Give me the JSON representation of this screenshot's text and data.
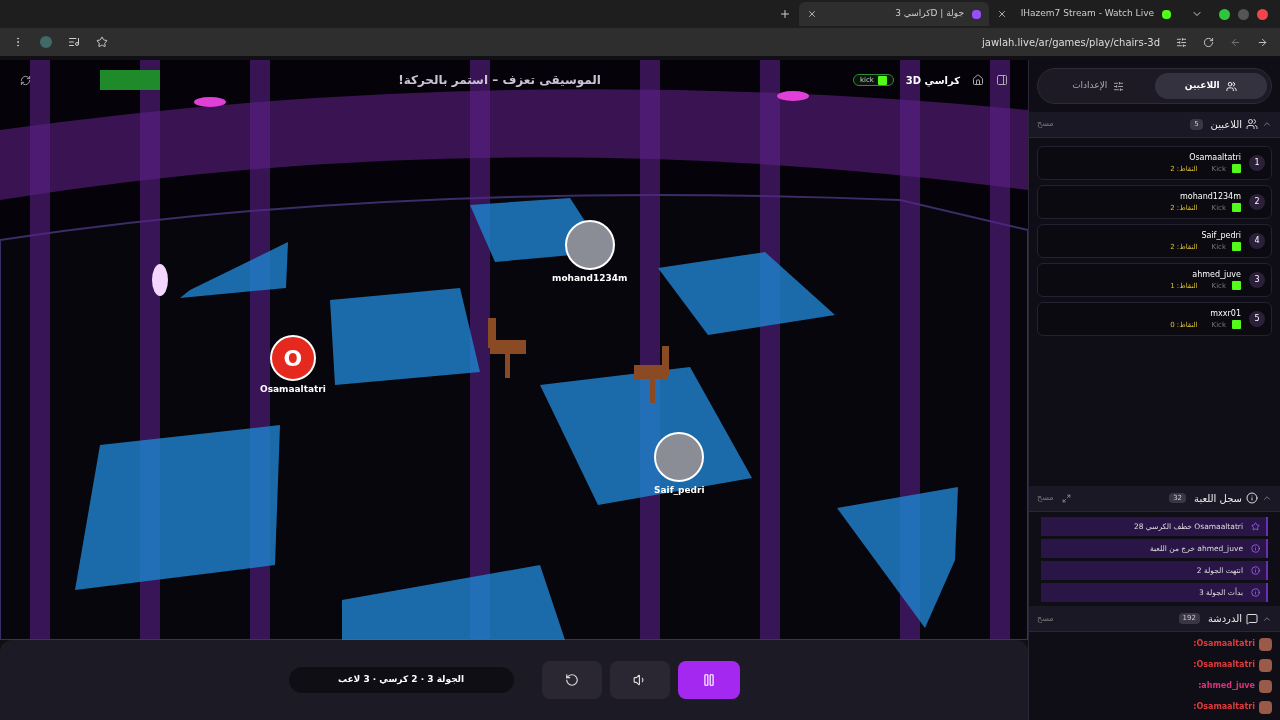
{
  "browser": {
    "tabs": [
      {
        "title": "IHazem7 Stream - Watch Live",
        "selected": false
      },
      {
        "title": "كراسي 3D | جولة",
        "selected": true
      }
    ],
    "url": "jawlah.live/ar/games/play/chairs-3d"
  },
  "game": {
    "name": "كراسي 3D",
    "platform": "kick",
    "message": "الموسيقى تعزف – استمر بالحركة!",
    "markers": [
      {
        "name": "mohand1234m",
        "kind": "photo"
      },
      {
        "name": "Osamaaltatri",
        "kind": "letter",
        "letter": "O"
      },
      {
        "name": "Saif_pedri",
        "kind": "photo"
      }
    ],
    "status": "الجولة 3 · 2 كرسي · 3 لاعب",
    "paused": false
  },
  "sidebar": {
    "tabs": [
      {
        "label": "اللاعبين",
        "selected": true
      },
      {
        "label": "الإعدادات",
        "selected": false
      }
    ],
    "players": {
      "title": "اللاعبين",
      "count": "5",
      "action": "مسح",
      "expanded": true,
      "items": [
        {
          "rank": "1",
          "name": "Osamaaltatri",
          "platform": "Kick",
          "points": "النقاط: 2"
        },
        {
          "rank": "2",
          "name": "mohand1234m",
          "platform": "Kick",
          "points": "النقاط: 2"
        },
        {
          "rank": "4",
          "name": "Saif_pedri",
          "platform": "Kick",
          "points": "النقاط: 2"
        },
        {
          "rank": "3",
          "name": "ahmed_juve",
          "platform": "Kick",
          "points": "النقاط: 1"
        },
        {
          "rank": "5",
          "name": "mxxr01",
          "platform": "Kick",
          "points": "النقاط: 0"
        }
      ]
    },
    "log": {
      "title": "سجل اللعبة",
      "count": "32",
      "action": "مسح",
      "expanded": true,
      "items": [
        {
          "kind": "star",
          "text": "Osamaaltatri خطف الكرسي 28"
        },
        {
          "kind": "info",
          "text": "ahmed_juve خرج من اللعبة"
        },
        {
          "kind": "info",
          "text": "انتهت الجولة 2"
        },
        {
          "kind": "info",
          "text": "بدأت الجولة 3"
        }
      ]
    },
    "chat": {
      "title": "الدردشة",
      "count": "192",
      "action": "مسح",
      "expanded": true,
      "items": [
        {
          "user": "Osamaaltatri:",
          "color": "#e23b3b"
        },
        {
          "user": "Osamaaltatri:",
          "color": "#e23b3b"
        },
        {
          "user": "ahmed_juve:",
          "color": "#e0307a"
        },
        {
          "user": "Osamaaltatri:",
          "color": "#e23b3b"
        }
      ]
    }
  }
}
